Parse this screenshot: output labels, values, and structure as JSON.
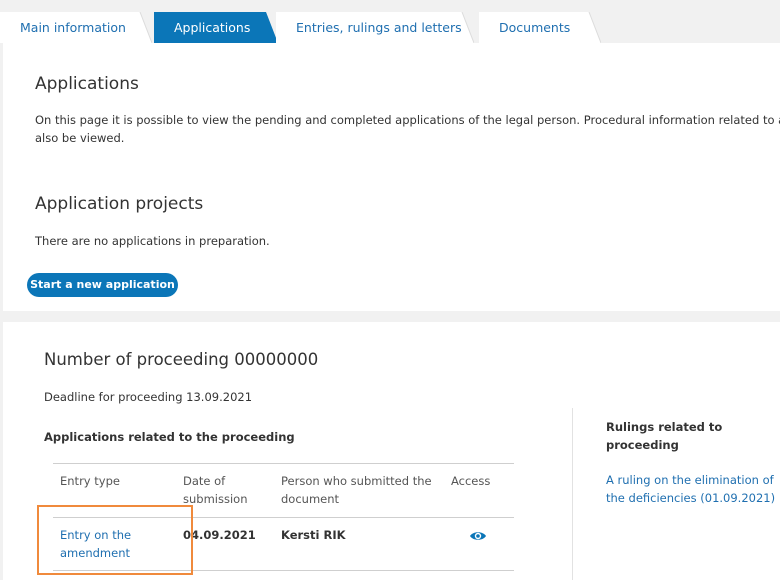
{
  "tabs": [
    {
      "label": "Main information",
      "active": false
    },
    {
      "label": "Applications",
      "active": true
    },
    {
      "label": "Entries, rulings and letters",
      "active": false
    },
    {
      "label": "Documents",
      "active": false
    }
  ],
  "applications": {
    "title": "Applications",
    "description_line1": "On this page it is possible to view the pending and completed applications of the legal person. Procedural information related to appli",
    "description_line2": "also be viewed."
  },
  "projects": {
    "title": "Application projects",
    "empty_text": "There are no applications in preparation.",
    "start_button": "Start a new application"
  },
  "proceeding": {
    "title": "Number of proceeding 00000000",
    "deadline": "Deadline for proceeding 13.09.2021",
    "apps_label": "Applications related to the proceeding",
    "columns": {
      "entry_type": "Entry type",
      "date_line1": "Date of",
      "date_line2": "submission",
      "person_line1": "Person who submitted the",
      "person_line2": "document",
      "access": "Access"
    },
    "rows": [
      {
        "entry_type_line1": "Entry on the",
        "entry_type_line2": "amendment",
        "date": "04.09.2021",
        "person": "Kersti RIK",
        "access_icon": "eye-icon"
      }
    ],
    "rulings_head_line1": "Rulings related to",
    "rulings_head_line2": "proceeding",
    "ruling_link_line1": "A ruling on the elimination of",
    "ruling_link_line2": "the deficiencies (01.09.2021)"
  },
  "colors": {
    "accent": "#0b76b8",
    "link": "#1f6fb0",
    "highlight": "#f08a3c",
    "background": "#f1f1f1"
  }
}
